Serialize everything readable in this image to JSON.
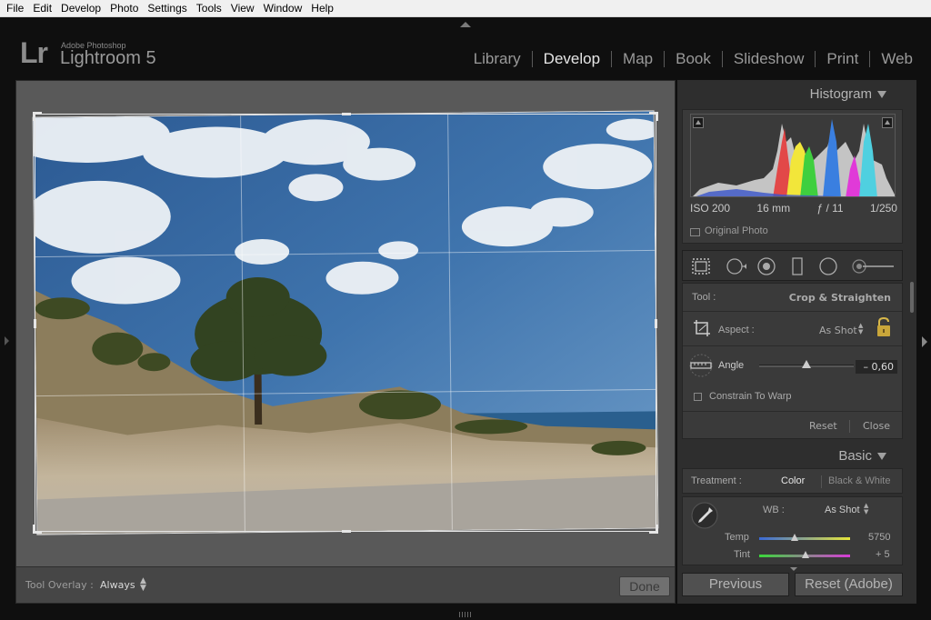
{
  "menu": [
    "File",
    "Edit",
    "Develop",
    "Photo",
    "Settings",
    "Tools",
    "View",
    "Window",
    "Help"
  ],
  "app": {
    "logo": "Lr",
    "vendor": "Adobe Photoshop",
    "name": "Lightroom 5"
  },
  "modules": [
    {
      "label": "Library",
      "active": false
    },
    {
      "label": "Develop",
      "active": true
    },
    {
      "label": "Map",
      "active": false
    },
    {
      "label": "Book",
      "active": false
    },
    {
      "label": "Slideshow",
      "active": false
    },
    {
      "label": "Print",
      "active": false
    },
    {
      "label": "Web",
      "active": false
    }
  ],
  "histogram": {
    "title": "Histogram",
    "iso": "ISO 200",
    "focal": "16 mm",
    "aperture": "ƒ / 11",
    "shutter": "1/250",
    "original_photo": "Original Photo"
  },
  "crop": {
    "tool_label": "Tool :",
    "tool_value": "Crop & Straighten",
    "aspect_label": "Aspect :",
    "aspect_value": "As Shot",
    "angle_label": "Angle",
    "angle_value": "– 0,60",
    "angle_fraction": 0.5,
    "constrain_label": "Constrain To Warp",
    "reset": "Reset",
    "close": "Close"
  },
  "basic": {
    "title": "Basic",
    "treatment_label": "Treatment :",
    "color": "Color",
    "bw": "Black & White",
    "wb_label": "WB :",
    "wb_value": "As Shot",
    "temp_label": "Temp",
    "temp_value": "5750",
    "tint_label": "Tint",
    "tint_value": "+ 5"
  },
  "toolbar": {
    "overlay_label": "Tool Overlay :",
    "overlay_value": "Always",
    "done": "Done"
  },
  "buttons": {
    "previous": "Previous",
    "reset_adobe": "Reset (Adobe)"
  },
  "colors": {
    "panel_bg": "#2e2e2e",
    "work_bg": "#595959",
    "active_text": "#e6e6e6"
  }
}
